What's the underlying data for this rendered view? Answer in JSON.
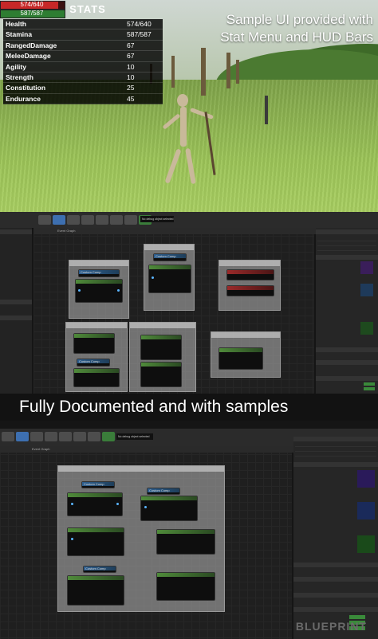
{
  "hud": {
    "health_bar_text": "574/640",
    "stamina_bar_text": "587/587",
    "health_fill": 0.897,
    "stamina_fill": 1.0,
    "colors": {
      "health": "#c62828",
      "stamina": "#2e7d32"
    }
  },
  "stats_menu": {
    "title": "STATS",
    "rows": [
      {
        "name": "Health",
        "value": "574/640"
      },
      {
        "name": "Stamina",
        "value": "587/587"
      },
      {
        "name": "RangedDamage",
        "value": "67"
      },
      {
        "name": "MeleeDamage",
        "value": "67"
      },
      {
        "name": "Agility",
        "value": "10"
      },
      {
        "name": "Strength",
        "value": "10"
      },
      {
        "name": "Constitution",
        "value": "25"
      },
      {
        "name": "Endurance",
        "value": "45"
      }
    ]
  },
  "captions": {
    "top_line1": "Sample UI provided with",
    "top_line2": "Stat Menu and HUD Bars",
    "middle": "Fully Documented and with samples",
    "watermark": "BLUEPRINT"
  },
  "editor": {
    "debug_filter": "No debug object selected",
    "graph_tab": "Event Graph",
    "component_labels": [
      "Custom Comp",
      "Custom Comp",
      "Custom Comp",
      "Custom Comp",
      "Custom Comp",
      "Custom Comp",
      "Custom Comp"
    ]
  }
}
